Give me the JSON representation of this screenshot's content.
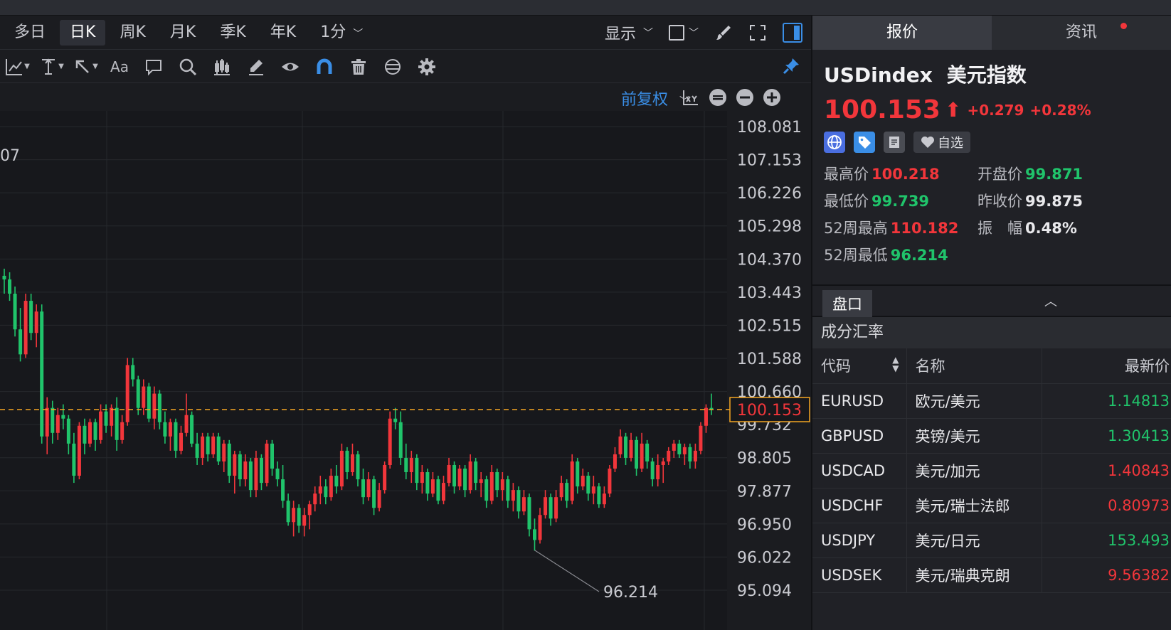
{
  "periods": [
    "多日",
    "日K",
    "周K",
    "月K",
    "季K",
    "年K",
    "1分"
  ],
  "active_period": "日K",
  "display_label": "显示",
  "toolbar_icons": [
    "indicator-icon",
    "measure-icon",
    "cursor-icon",
    "text-icon",
    "comment-icon",
    "search-icon",
    "candle-icon",
    "pen-icon",
    "eye-icon",
    "magnet-icon",
    "trash-icon",
    "sync-icon",
    "gear-icon"
  ],
  "text_tool_label": "Aa",
  "adjust_label": "前复权",
  "chart_data": {
    "type": "candlestick",
    "left_edge_label": "07",
    "y_ticks": [
      "108.081",
      "107.153",
      "106.226",
      "105.298",
      "104.370",
      "103.443",
      "102.515",
      "101.588",
      "100.660",
      "99.732",
      "98.805",
      "97.877",
      "96.950",
      "96.022",
      "95.094"
    ],
    "ylim": [
      95.094,
      108.081
    ],
    "last_price": "100.153",
    "min_label": "96.214",
    "min_value": 96.214,
    "candles": [
      [
        103.9,
        104.1,
        103.4,
        103.8
      ],
      [
        103.8,
        104.0,
        103.2,
        103.4
      ],
      [
        103.4,
        103.6,
        102.2,
        102.4
      ],
      [
        102.4,
        103.0,
        101.5,
        101.7
      ],
      [
        101.7,
        103.4,
        101.6,
        103.2
      ],
      [
        103.2,
        103.4,
        102.1,
        102.3
      ],
      [
        102.3,
        103.1,
        101.9,
        102.9
      ],
      [
        102.9,
        103.1,
        99.2,
        99.4
      ],
      [
        99.4,
        100.5,
        98.9,
        100.2
      ],
      [
        100.2,
        100.4,
        99.2,
        99.5
      ],
      [
        99.5,
        100.2,
        99.3,
        100.0
      ],
      [
        100.0,
        100.3,
        99.6,
        99.9
      ],
      [
        99.9,
        100.0,
        98.9,
        99.2
      ],
      [
        99.2,
        99.5,
        98.1,
        98.3
      ],
      [
        98.3,
        99.8,
        98.2,
        99.7
      ],
      [
        99.7,
        99.9,
        98.9,
        99.2
      ],
      [
        99.2,
        99.9,
        99.1,
        99.8
      ],
      [
        99.8,
        99.9,
        99.0,
        99.3
      ],
      [
        99.3,
        100.3,
        99.2,
        100.1
      ],
      [
        100.1,
        100.3,
        99.5,
        99.7
      ],
      [
        99.7,
        100.3,
        99.4,
        100.2
      ],
      [
        100.2,
        100.5,
        99.0,
        99.3
      ],
      [
        99.3,
        100.0,
        99.2,
        99.8
      ],
      [
        99.8,
        101.6,
        99.7,
        101.4
      ],
      [
        101.4,
        101.6,
        100.8,
        101.0
      ],
      [
        101.0,
        101.1,
        100.0,
        100.2
      ],
      [
        100.2,
        101.0,
        100.0,
        100.8
      ],
      [
        100.8,
        100.9,
        99.8,
        99.9
      ],
      [
        99.9,
        100.8,
        99.6,
        100.6
      ],
      [
        100.6,
        100.7,
        99.6,
        99.8
      ],
      [
        99.8,
        100.1,
        99.2,
        99.4
      ],
      [
        99.4,
        99.9,
        99.0,
        99.8
      ],
      [
        99.8,
        99.9,
        98.8,
        99.0
      ],
      [
        99.0,
        99.7,
        98.9,
        99.5
      ],
      [
        99.5,
        100.6,
        99.4,
        100.0
      ],
      [
        100.0,
        100.1,
        99.1,
        99.2
      ],
      [
        99.2,
        99.5,
        98.6,
        98.8
      ],
      [
        98.8,
        99.5,
        98.6,
        99.4
      ],
      [
        99.4,
        99.5,
        98.7,
        98.9
      ],
      [
        98.9,
        99.5,
        98.8,
        99.4
      ],
      [
        99.4,
        99.5,
        98.6,
        98.7
      ],
      [
        98.7,
        99.3,
        98.4,
        99.2
      ],
      [
        99.2,
        99.3,
        98.1,
        98.3
      ],
      [
        98.3,
        99.0,
        97.8,
        98.9
      ],
      [
        98.9,
        99.0,
        98.0,
        98.2
      ],
      [
        98.2,
        98.9,
        98.0,
        98.7
      ],
      [
        98.7,
        98.8,
        97.7,
        97.9
      ],
      [
        97.9,
        99.0,
        97.7,
        98.8
      ],
      [
        98.8,
        98.9,
        97.9,
        98.1
      ],
      [
        98.1,
        99.3,
        98.0,
        99.2
      ],
      [
        99.2,
        99.3,
        98.3,
        98.5
      ],
      [
        98.5,
        98.7,
        98.0,
        98.2
      ],
      [
        98.2,
        98.6,
        97.4,
        97.6
      ],
      [
        97.6,
        97.8,
        96.9,
        97.0
      ],
      [
        97.0,
        97.6,
        96.6,
        97.4
      ],
      [
        97.4,
        97.5,
        96.7,
        96.9
      ],
      [
        96.9,
        97.4,
        96.6,
        97.2
      ],
      [
        97.2,
        97.6,
        96.8,
        97.5
      ],
      [
        97.5,
        98.0,
        97.3,
        97.8
      ],
      [
        97.8,
        98.3,
        97.5,
        98.0
      ],
      [
        98.0,
        98.2,
        97.5,
        97.7
      ],
      [
        97.7,
        98.5,
        97.6,
        98.3
      ],
      [
        98.3,
        98.6,
        97.8,
        98.0
      ],
      [
        98.0,
        99.2,
        97.9,
        99.0
      ],
      [
        99.0,
        99.1,
        98.2,
        98.4
      ],
      [
        98.4,
        99.2,
        98.3,
        98.9
      ],
      [
        98.9,
        99.0,
        98.0,
        98.2
      ],
      [
        98.2,
        98.5,
        97.5,
        97.7
      ],
      [
        97.7,
        98.4,
        97.6,
        98.2
      ],
      [
        98.2,
        98.3,
        97.2,
        97.4
      ],
      [
        97.4,
        98.1,
        97.3,
        97.9
      ],
      [
        97.9,
        98.7,
        97.8,
        98.6
      ],
      [
        98.6,
        100.1,
        98.5,
        99.9
      ],
      [
        99.9,
        100.2,
        99.6,
        99.8
      ],
      [
        99.8,
        100.1,
        98.6,
        98.8
      ],
      [
        98.8,
        99.2,
        98.2,
        98.4
      ],
      [
        98.4,
        99.0,
        98.1,
        98.8
      ],
      [
        98.8,
        98.9,
        97.9,
        98.1
      ],
      [
        98.1,
        98.6,
        97.8,
        98.4
      ],
      [
        98.4,
        98.5,
        97.6,
        97.8
      ],
      [
        97.8,
        98.4,
        97.7,
        98.2
      ],
      [
        98.2,
        98.3,
        97.5,
        97.6
      ],
      [
        97.6,
        98.3,
        97.5,
        98.1
      ],
      [
        98.1,
        98.8,
        98.0,
        98.6
      ],
      [
        98.6,
        98.7,
        97.8,
        98.0
      ],
      [
        98.0,
        98.6,
        97.9,
        98.5
      ],
      [
        98.5,
        98.6,
        97.7,
        97.9
      ],
      [
        97.9,
        98.9,
        97.8,
        98.7
      ],
      [
        98.7,
        98.8,
        97.9,
        98.1
      ],
      [
        98.1,
        98.4,
        97.7,
        98.2
      ],
      [
        98.2,
        98.3,
        97.4,
        97.6
      ],
      [
        97.6,
        98.6,
        97.5,
        98.4
      ],
      [
        98.4,
        98.5,
        97.7,
        97.9
      ],
      [
        97.9,
        98.4,
        97.6,
        98.2
      ],
      [
        98.2,
        98.3,
        97.4,
        97.6
      ],
      [
        97.6,
        98.1,
        97.3,
        97.9
      ],
      [
        97.9,
        98.0,
        97.1,
        97.3
      ],
      [
        97.3,
        97.9,
        97.2,
        97.7
      ],
      [
        97.7,
        97.8,
        96.6,
        96.8
      ],
      [
        96.8,
        97.1,
        96.2,
        96.5
      ],
      [
        96.5,
        97.4,
        96.4,
        97.2
      ],
      [
        97.2,
        97.9,
        97.1,
        97.7
      ],
      [
        97.7,
        97.8,
        96.9,
        97.1
      ],
      [
        97.1,
        97.9,
        97.0,
        97.7
      ],
      [
        97.7,
        98.3,
        97.6,
        98.1
      ],
      [
        98.1,
        98.2,
        97.4,
        97.6
      ],
      [
        97.6,
        98.9,
        97.5,
        98.7
      ],
      [
        98.7,
        98.8,
        97.8,
        98.0
      ],
      [
        98.0,
        98.5,
        97.9,
        98.3
      ],
      [
        98.3,
        98.4,
        97.6,
        97.8
      ],
      [
        97.8,
        98.3,
        97.5,
        98.0
      ],
      [
        98.0,
        98.1,
        97.4,
        97.5
      ],
      [
        97.5,
        98.0,
        97.4,
        97.8
      ],
      [
        97.8,
        98.6,
        97.7,
        98.5
      ],
      [
        98.5,
        99.1,
        98.4,
        98.9
      ],
      [
        98.9,
        99.6,
        98.8,
        99.4
      ],
      [
        99.4,
        99.5,
        98.6,
        98.8
      ],
      [
        98.8,
        99.5,
        98.7,
        99.3
      ],
      [
        99.3,
        99.4,
        98.3,
        98.5
      ],
      [
        98.5,
        99.5,
        98.4,
        99.2
      ],
      [
        99.2,
        99.3,
        98.5,
        98.7
      ],
      [
        98.7,
        98.8,
        98.0,
        98.2
      ],
      [
        98.2,
        98.9,
        98.0,
        98.6
      ],
      [
        98.6,
        98.8,
        98.1,
        98.7
      ],
      [
        98.7,
        99.1,
        98.6,
        99.0
      ],
      [
        99.0,
        99.3,
        98.8,
        99.2
      ],
      [
        99.2,
        99.3,
        98.8,
        98.9
      ],
      [
        98.9,
        99.2,
        98.6,
        99.1
      ],
      [
        99.1,
        99.2,
        98.5,
        98.7
      ],
      [
        98.7,
        99.2,
        98.5,
        99.0
      ],
      [
        99.0,
        99.8,
        98.9,
        99.7
      ],
      [
        99.7,
        100.3,
        99.5,
        100.2
      ],
      [
        100.2,
        100.6,
        100.0,
        100.15
      ]
    ]
  },
  "right_panel": {
    "tabs": [
      "报价",
      "资讯"
    ],
    "symbol": "USDindex",
    "symbol_name": "美元指数",
    "price": "100.153",
    "price_arrow": "⬆",
    "change": "+0.279",
    "change_pct": "+0.28%",
    "watch_label": "自选",
    "stats": [
      {
        "k": "最高价",
        "v": "100.218",
        "c": "red"
      },
      {
        "k": "开盘价",
        "v": "99.871",
        "c": "green"
      },
      {
        "k": "最低价",
        "v": "99.739",
        "c": "green"
      },
      {
        "k": "昨收价",
        "v": "99.875",
        "c": "white"
      },
      {
        "k": "52周最高",
        "v": "110.182",
        "c": "red"
      },
      {
        "k": "振　幅",
        "v": "0.48%",
        "c": "white"
      },
      {
        "k": "52周最低",
        "v": "96.214",
        "c": "green"
      }
    ],
    "pankou_label": "盘口",
    "components_title": "成分汇率",
    "table_headers": [
      "代码",
      "名称",
      "最新价"
    ],
    "rows": [
      {
        "code": "EURUSD",
        "name": "欧元/美元",
        "price": "1.14813",
        "c": "green"
      },
      {
        "code": "GBPUSD",
        "name": "英镑/美元",
        "price": "1.30413",
        "c": "green"
      },
      {
        "code": "USDCAD",
        "name": "美元/加元",
        "price": "1.40843",
        "c": "red"
      },
      {
        "code": "USDCHF",
        "name": "美元/瑞士法郎",
        "price": "0.80973",
        "c": "red"
      },
      {
        "code": "USDJPY",
        "name": "美元/日元",
        "price": "153.493",
        "c": "green"
      },
      {
        "code": "USDSEK",
        "name": "美元/瑞典克朗",
        "price": "9.56382",
        "c": "red"
      }
    ]
  }
}
